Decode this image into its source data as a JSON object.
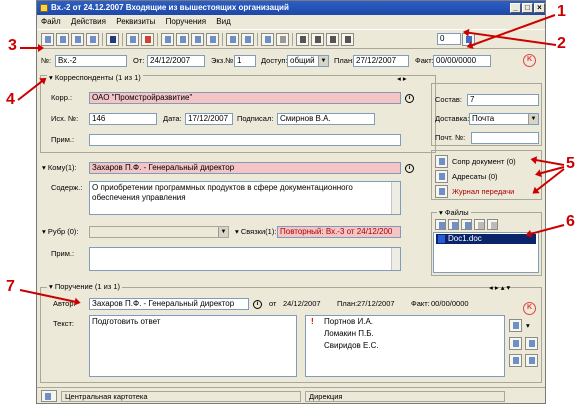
{
  "window": {
    "title": "Вх.-2 от 24.12.2007 Входящие из вышестоящих организаций"
  },
  "menu": [
    "Файл",
    "Действия",
    "Реквизиты",
    "Поручения",
    "Вид"
  ],
  "toolbar": {
    "counter_value": "0"
  },
  "header": {
    "number_label": "№:",
    "number_value": "Вх.-2",
    "from_label": "От:",
    "from_value": "24/12/2007",
    "copy_label": "Экз.№:",
    "copy_value": "1",
    "access_label": "Доступ:",
    "access_value": "общий",
    "plan_label": "План:",
    "plan_value": "27/12/2007",
    "fact_label": "Факт:",
    "fact_value": "00/00/0000"
  },
  "correspondents": {
    "title": "Корреспонденты (1 из 1)",
    "corr_label": "Корр.:",
    "corr_value": "ОАО \"Промстройразвитие\"",
    "out_num_label": "Исх. №:",
    "out_num_value": "146",
    "date_label": "Дата:",
    "date_value": "17/12/2007",
    "signed_label": "Подписал:",
    "signed_value": "Смирнов В.А.",
    "note_label": "Прим.:",
    "note_value": ""
  },
  "right_panel": {
    "composition_label": "Состав:",
    "composition_value": "7",
    "delivery_label": "Доставка:",
    "delivery_value": "Почта",
    "post_num_label": "Почт. №:",
    "post_num_value": "",
    "links": [
      "Сопр документ (0)",
      "Адресаты (0)",
      "Журнал передачи"
    ],
    "files_title": "Файлы",
    "files": [
      "Doc1.doc"
    ]
  },
  "addressee": {
    "to_label": "Кому(1):",
    "to_value": "Захаров П.Ф. - Генеральный директор",
    "content_label": "Содерж.:",
    "content_value": "О приобретении программных продуктов в сфере документационного обеспечения управления",
    "rubric_label": "Рубр (0):",
    "rubric_value": "",
    "links_label": "Связки(1):",
    "links_value": "Повторный: Вх.-3 от 24/12/200",
    "note_label": "Прим.:",
    "note_value": ""
  },
  "assignment": {
    "title": "Поручение (1 из 1)",
    "author_label": "Автор:",
    "author_value": "Захаров П.Ф. - Генеральный директор",
    "from_label": "от",
    "from_value": "24/12/2007",
    "plan_label": "План:",
    "plan_value": "27/12/2007",
    "fact_label": "Факт:",
    "fact_value": "00/00/0000",
    "text_label": "Текст:",
    "text_value": "Подготовить ответ",
    "executors": [
      "Портнов И.А.",
      "Ломакин П.Б.",
      "Свиридов Е.С."
    ]
  },
  "status": {
    "left": "Центральная картотека",
    "right": "Дирекция"
  },
  "callouts": [
    "1",
    "2",
    "3",
    "4",
    "5",
    "6",
    "7"
  ],
  "colors": {
    "accent_red": "#cc0000",
    "required_pink": "#f5c4c4",
    "titlebar_blue": "#1e47a8"
  }
}
